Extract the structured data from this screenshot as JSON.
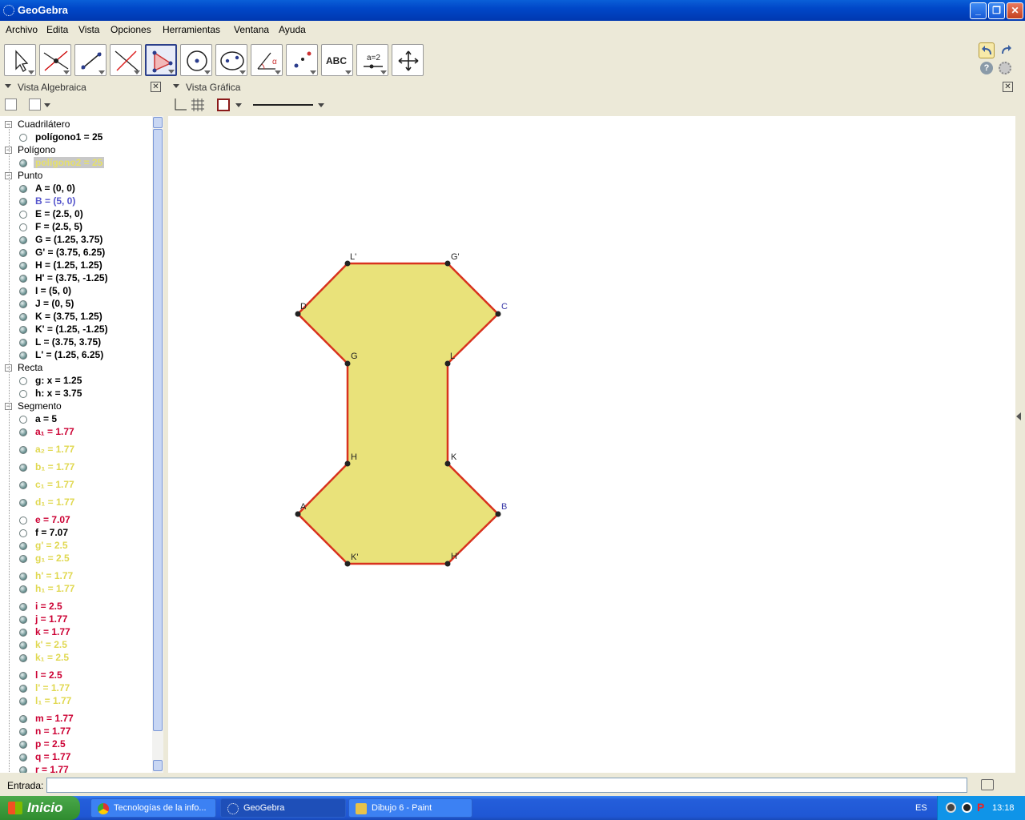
{
  "window": {
    "title": "GeoGebra"
  },
  "menu": [
    "Archivo",
    "Edita",
    "Vista",
    "Opciones",
    "Herramientas",
    "Ventana",
    "Ayuda"
  ],
  "toolbar": {
    "tools": [
      {
        "icon": "move-arrow-icon"
      },
      {
        "icon": "intersect-point-icon"
      },
      {
        "icon": "line-icon"
      },
      {
        "icon": "perpendicular-line-icon"
      },
      {
        "icon": "polygon-icon",
        "selected": true
      },
      {
        "icon": "circle-icon"
      },
      {
        "icon": "ellipse-icon"
      },
      {
        "icon": "angle-icon"
      },
      {
        "icon": "reflect-icon"
      },
      {
        "icon": "text-icon",
        "label": "ABC"
      },
      {
        "icon": "slider-icon",
        "label": "a=2"
      },
      {
        "icon": "move-view-icon"
      }
    ]
  },
  "algebra_view": {
    "title": "Vista Algebraica",
    "rows": [
      {
        "type": "cat",
        "text": "Cuadrilátero"
      },
      {
        "type": "item",
        "text": "polígono1 = 25",
        "color": "#000000",
        "shown": false
      },
      {
        "type": "cat",
        "text": "Polígono"
      },
      {
        "type": "item",
        "text": "polígono2 = 25",
        "color": "#e6e06a",
        "shown": true,
        "selected": true
      },
      {
        "type": "cat",
        "text": "Punto"
      },
      {
        "type": "item",
        "text": "A = (0, 0)",
        "color": "#000000",
        "shown": true
      },
      {
        "type": "item",
        "text": "B = (5, 0)",
        "color": "#5555cc",
        "shown": true
      },
      {
        "type": "item",
        "text": "E = (2.5, 0)",
        "color": "#000000",
        "shown": false
      },
      {
        "type": "item",
        "text": "F = (2.5, 5)",
        "color": "#000000",
        "shown": false
      },
      {
        "type": "item",
        "text": "G = (1.25, 3.75)",
        "color": "#000000",
        "shown": true
      },
      {
        "type": "item",
        "text": "G' = (3.75, 6.25)",
        "color": "#000000",
        "shown": true
      },
      {
        "type": "item",
        "text": "H = (1.25, 1.25)",
        "color": "#000000",
        "shown": true
      },
      {
        "type": "item",
        "text": "H' = (3.75, -1.25)",
        "color": "#000000",
        "shown": true
      },
      {
        "type": "item",
        "text": "I = (5, 0)",
        "color": "#000000",
        "shown": true
      },
      {
        "type": "item",
        "text": "J = (0, 5)",
        "color": "#000000",
        "shown": true
      },
      {
        "type": "item",
        "text": "K = (3.75, 1.25)",
        "color": "#000000",
        "shown": true
      },
      {
        "type": "item",
        "text": "K' = (1.25, -1.25)",
        "color": "#000000",
        "shown": true
      },
      {
        "type": "item",
        "text": "L = (3.75, 3.75)",
        "color": "#000000",
        "shown": true
      },
      {
        "type": "item",
        "text": "L' = (1.25, 6.25)",
        "color": "#000000",
        "shown": true
      },
      {
        "type": "cat",
        "text": "Recta"
      },
      {
        "type": "item",
        "text": "g: x = 1.25",
        "color": "#000000",
        "shown": false
      },
      {
        "type": "item",
        "text": "h: x = 3.75",
        "color": "#000000",
        "shown": false
      },
      {
        "type": "cat",
        "text": "Segmento"
      },
      {
        "type": "item",
        "text": "a = 5",
        "color": "#000000",
        "shown": false
      },
      {
        "type": "item",
        "text": "a₁ = 1.77",
        "color": "#cc0033",
        "shown": true
      },
      {
        "type": "item",
        "text": "a₂ = 1.77",
        "color": "#e0d850",
        "shown": true
      },
      {
        "type": "item",
        "text": "b₁ = 1.77",
        "color": "#e0d850",
        "shown": true
      },
      {
        "type": "item",
        "text": "c₁ = 1.77",
        "color": "#e0d850",
        "shown": true
      },
      {
        "type": "item",
        "text": "d₁ = 1.77",
        "color": "#e0d850",
        "shown": true
      },
      {
        "type": "item",
        "text": "e = 7.07",
        "color": "#cc0033",
        "shown": false
      },
      {
        "type": "item",
        "text": "f = 7.07",
        "color": "#000000",
        "shown": false
      },
      {
        "type": "item",
        "text": "g' = 2.5",
        "color": "#e0d850",
        "shown": true
      },
      {
        "type": "item",
        "text": "g₁ = 2.5",
        "color": "#e0d850",
        "shown": true
      },
      {
        "type": "item",
        "text": "h' = 1.77",
        "color": "#e0d850",
        "shown": true
      },
      {
        "type": "item",
        "text": "h₁ = 1.77",
        "color": "#e0d850",
        "shown": true
      },
      {
        "type": "item",
        "text": "i = 2.5",
        "color": "#cc0033",
        "shown": true
      },
      {
        "type": "item",
        "text": "j = 1.77",
        "color": "#cc0033",
        "shown": true
      },
      {
        "type": "item",
        "text": "k = 1.77",
        "color": "#cc0033",
        "shown": true
      },
      {
        "type": "item",
        "text": "k' = 2.5",
        "color": "#e0d850",
        "shown": true
      },
      {
        "type": "item",
        "text": "k₁ = 2.5",
        "color": "#e0d850",
        "shown": true
      },
      {
        "type": "item",
        "text": "l = 2.5",
        "color": "#cc0033",
        "shown": true
      },
      {
        "type": "item",
        "text": "l' = 1.77",
        "color": "#e0d850",
        "shown": true
      },
      {
        "type": "item",
        "text": "l₁ = 1.77",
        "color": "#e0d850",
        "shown": true
      },
      {
        "type": "item",
        "text": "m = 1.77",
        "color": "#cc0033",
        "shown": true
      },
      {
        "type": "item",
        "text": "n = 1.77",
        "color": "#cc0033",
        "shown": true
      },
      {
        "type": "item",
        "text": "p = 2.5",
        "color": "#cc0033",
        "shown": true
      },
      {
        "type": "item",
        "text": "q = 1.77",
        "color": "#cc0033",
        "shown": true
      },
      {
        "type": "item",
        "text": "r = 1.77",
        "color": "#cc0033",
        "shown": true
      }
    ]
  },
  "graphics_view": {
    "title": "Vista Gráfica",
    "fill_color": "#e9e27a",
    "stroke_color": "#d8321e",
    "points": [
      {
        "label": "L'"
      },
      {
        "label": "G'"
      },
      {
        "label": "C"
      },
      {
        "label": "L"
      },
      {
        "label": "K"
      },
      {
        "label": "B"
      },
      {
        "label": "H'"
      },
      {
        "label": "K'"
      },
      {
        "label": "A"
      },
      {
        "label": "H"
      },
      {
        "label": "G"
      },
      {
        "label": "D"
      }
    ]
  },
  "input_bar": {
    "label": "Entrada:",
    "value": ""
  },
  "taskbar": {
    "start": "Inicio",
    "tasks": [
      "Tecnologías de la info...",
      "GeoGebra",
      "Dibujo 6 - Paint"
    ],
    "lang": "ES",
    "time": "13:18"
  }
}
